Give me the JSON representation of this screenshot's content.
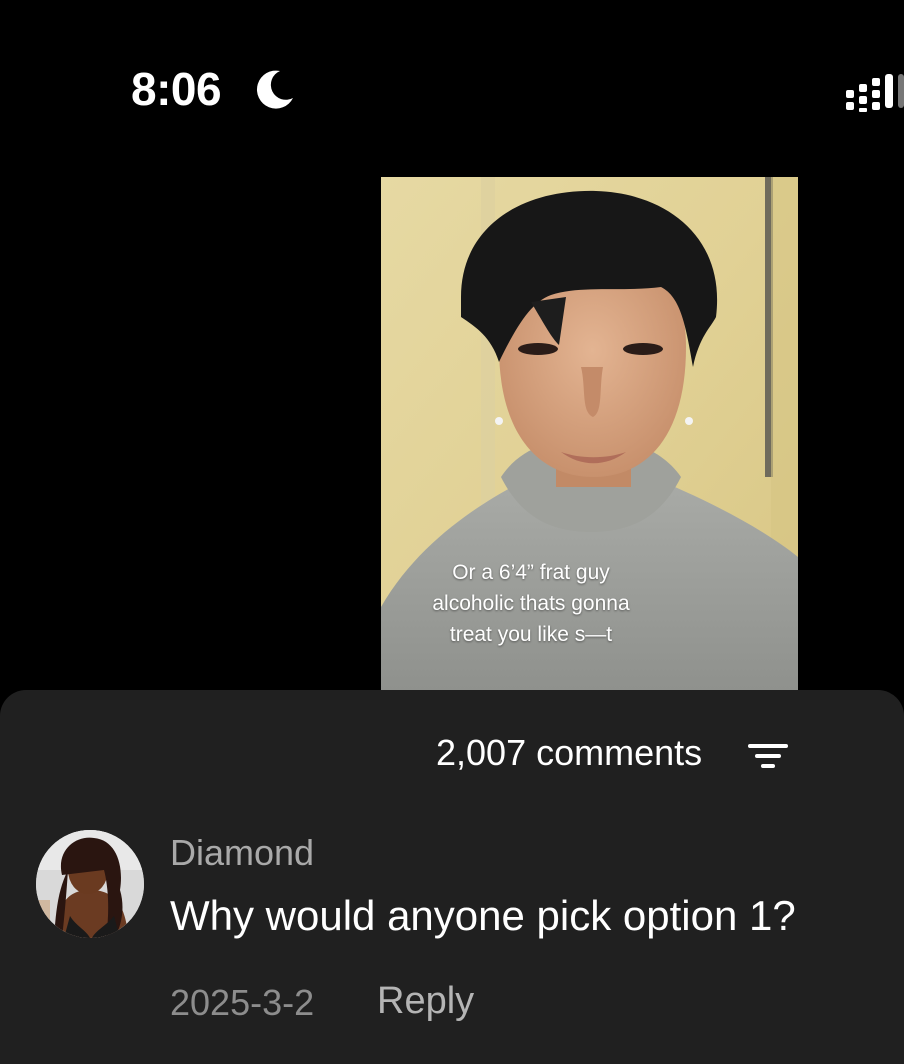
{
  "status_bar": {
    "time": "8:06",
    "moon_icon": "moon-icon",
    "signal_icon": "signal-icon"
  },
  "video": {
    "caption_lines": [
      "Or a 6’4” frat guy",
      "alcoholic thats gonna",
      "treat you like s—t"
    ]
  },
  "comments": {
    "count_label": "2,007 comments",
    "filter_icon": "filter-icon",
    "items": [
      {
        "author": "Diamond",
        "text": "Why would anyone pick option 1?",
        "date": "2025-3-2",
        "reply_label": "Reply"
      }
    ]
  }
}
